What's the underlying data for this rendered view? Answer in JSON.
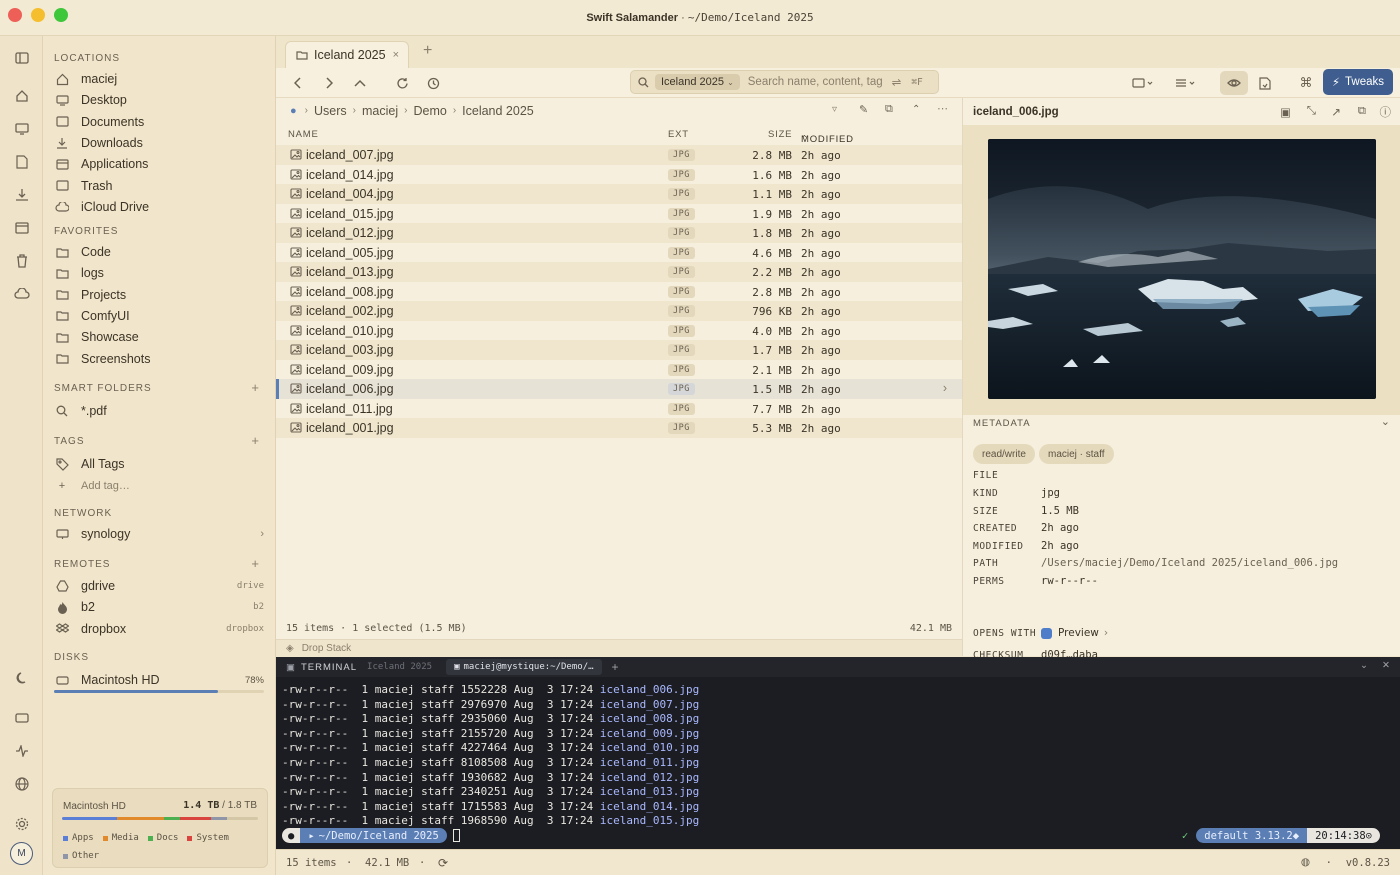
{
  "window": {
    "app_name": "Swift Salamander",
    "path": "~/Demo/Iceland 2025",
    "separator": "·"
  },
  "sidebar": {
    "locations_title": "LOCATIONS",
    "locations": [
      "maciej",
      "Desktop",
      "Documents",
      "Downloads",
      "Applications",
      "Trash",
      "iCloud Drive"
    ],
    "favorites_title": "FAVORITES",
    "favorites": [
      "Code",
      "logs",
      "Projects",
      "ComfyUI",
      "Showcase",
      "Screenshots"
    ],
    "smart_title": "SMART FOLDERS",
    "smart": [
      "*.pdf"
    ],
    "tags_title": "TAGS",
    "tags": [
      "All Tags"
    ],
    "add_tag": "Add tag…",
    "network_title": "NETWORK",
    "network": [
      "synology"
    ],
    "remotes_title": "REMOTES",
    "remotes": [
      {
        "name": "gdrive",
        "type": "drive"
      },
      {
        "name": "b2",
        "type": "b2"
      },
      {
        "name": "dropbox",
        "type": "dropbox"
      }
    ],
    "disks_title": "DISKS",
    "disk": {
      "name": "Macintosh HD",
      "percent": "78%",
      "fill": 0.78
    },
    "storage": {
      "name": "Macintosh HD",
      "used": "1.4 TB",
      "total": "/ 1.8 TB",
      "legend": [
        {
          "label": "Apps",
          "color": "#5b7fd6"
        },
        {
          "label": "Media",
          "color": "#e08a2c"
        },
        {
          "label": "Docs",
          "color": "#4caf50"
        },
        {
          "label": "System",
          "color": "#d9453e"
        },
        {
          "label": "Other",
          "color": "#8f96a8"
        }
      ]
    }
  },
  "tab": {
    "label": "Iceland 2025"
  },
  "search": {
    "scope": "Iceland 2025",
    "placeholder": "Search name, content, tag",
    "shortcut": "⌘F"
  },
  "toolbar": {
    "tweaks_label": "Tweaks"
  },
  "breadcrumb": [
    "Users",
    "maciej",
    "Demo",
    "Iceland 2025"
  ],
  "table": {
    "headers": {
      "name": "NAME",
      "ext": "EXT",
      "size": "SIZE",
      "modified": "MODIFIED"
    },
    "rows": [
      {
        "name": "iceland_007.jpg",
        "ext": "JPG",
        "size": "2.8 MB",
        "modified": "2h ago"
      },
      {
        "name": "iceland_014.jpg",
        "ext": "JPG",
        "size": "1.6 MB",
        "modified": "2h ago"
      },
      {
        "name": "iceland_004.jpg",
        "ext": "JPG",
        "size": "1.1 MB",
        "modified": "2h ago"
      },
      {
        "name": "iceland_015.jpg",
        "ext": "JPG",
        "size": "1.9 MB",
        "modified": "2h ago"
      },
      {
        "name": "iceland_012.jpg",
        "ext": "JPG",
        "size": "1.8 MB",
        "modified": "2h ago"
      },
      {
        "name": "iceland_005.jpg",
        "ext": "JPG",
        "size": "4.6 MB",
        "modified": "2h ago"
      },
      {
        "name": "iceland_013.jpg",
        "ext": "JPG",
        "size": "2.2 MB",
        "modified": "2h ago"
      },
      {
        "name": "iceland_008.jpg",
        "ext": "JPG",
        "size": "2.8 MB",
        "modified": "2h ago"
      },
      {
        "name": "iceland_002.jpg",
        "ext": "JPG",
        "size": "796 KB",
        "modified": "2h ago"
      },
      {
        "name": "iceland_010.jpg",
        "ext": "JPG",
        "size": "4.0 MB",
        "modified": "2h ago"
      },
      {
        "name": "iceland_003.jpg",
        "ext": "JPG",
        "size": "1.7 MB",
        "modified": "2h ago"
      },
      {
        "name": "iceland_009.jpg",
        "ext": "JPG",
        "size": "2.1 MB",
        "modified": "2h ago"
      },
      {
        "name": "iceland_006.jpg",
        "ext": "JPG",
        "size": "1.5 MB",
        "modified": "2h ago",
        "selected": true
      },
      {
        "name": "iceland_011.jpg",
        "ext": "JPG",
        "size": "7.7 MB",
        "modified": "2h ago"
      },
      {
        "name": "iceland_001.jpg",
        "ext": "JPG",
        "size": "5.3 MB",
        "modified": "2h ago"
      }
    ]
  },
  "status": {
    "summary": "15 items · 1 selected (1.5 MB)",
    "total": "42.1 MB",
    "drop_stack": "Drop Stack"
  },
  "preview": {
    "filename": "iceland_006.jpg",
    "metadata_title": "METADATA",
    "pills": [
      "read/write",
      "maciej · staff"
    ],
    "file_title": "FILE",
    "fields": [
      {
        "k": "KIND",
        "v": "jpg"
      },
      {
        "k": "SIZE",
        "v": "1.5 MB"
      },
      {
        "k": "CREATED",
        "v": "2h ago"
      },
      {
        "k": "MODIFIED",
        "v": "2h ago"
      },
      {
        "k": "PATH",
        "v": "/Users/maciej/Demo/Iceland 2025/iceland_006.jpg"
      },
      {
        "k": "PERMS",
        "v": "rw-r--r--"
      }
    ],
    "opens_with_label": "OPENS WITH",
    "opens_with": "Preview",
    "checksum_label": "CHECKSUM",
    "checksum": "d09f…daba"
  },
  "terminal": {
    "title": "TERMINAL",
    "context": "Iceland 2025",
    "session": "maciej@mystique:~/Demo/…",
    "lines": [
      {
        "text": "-rw-r--r--  1 maciej staff 1552228 Aug  3 17:24 ",
        "file": "iceland_006.jpg"
      },
      {
        "text": "-rw-r--r--  1 maciej staff 2976970 Aug  3 17:24 ",
        "file": "iceland_007.jpg"
      },
      {
        "text": "-rw-r--r--  1 maciej staff 2935060 Aug  3 17:24 ",
        "file": "iceland_008.jpg"
      },
      {
        "text": "-rw-r--r--  1 maciej staff 2155720 Aug  3 17:24 ",
        "file": "iceland_009.jpg"
      },
      {
        "text": "-rw-r--r--  1 maciej staff 4227464 Aug  3 17:24 ",
        "file": "iceland_010.jpg"
      },
      {
        "text": "-rw-r--r--  1 maciej staff 8108508 Aug  3 17:24 ",
        "file": "iceland_011.jpg"
      },
      {
        "text": "-rw-r--r--  1 maciej staff 1930682 Aug  3 17:24 ",
        "file": "iceland_012.jpg"
      },
      {
        "text": "-rw-r--r--  1 maciej staff 2340251 Aug  3 17:24 ",
        "file": "iceland_013.jpg"
      },
      {
        "text": "-rw-r--r--  1 maciej staff 1715583 Aug  3 17:24 ",
        "file": "iceland_014.jpg"
      },
      {
        "text": "-rw-r--r--  1 maciej staff 1968590 Aug  3 17:24 ",
        "file": "iceland_015.jpg"
      }
    ],
    "prompt_path": "~/Demo/Iceland 2025",
    "check": "✓",
    "env": "default 3.13.2",
    "clock": "20:14:38"
  },
  "bottombar": {
    "items": "15 items",
    "size": "42.1 MB",
    "version": "v0.8.23"
  },
  "colors": {
    "accent": "#3f5e8f",
    "bg": "#f1e7cf",
    "terminal_bg": "#1c1d22"
  }
}
